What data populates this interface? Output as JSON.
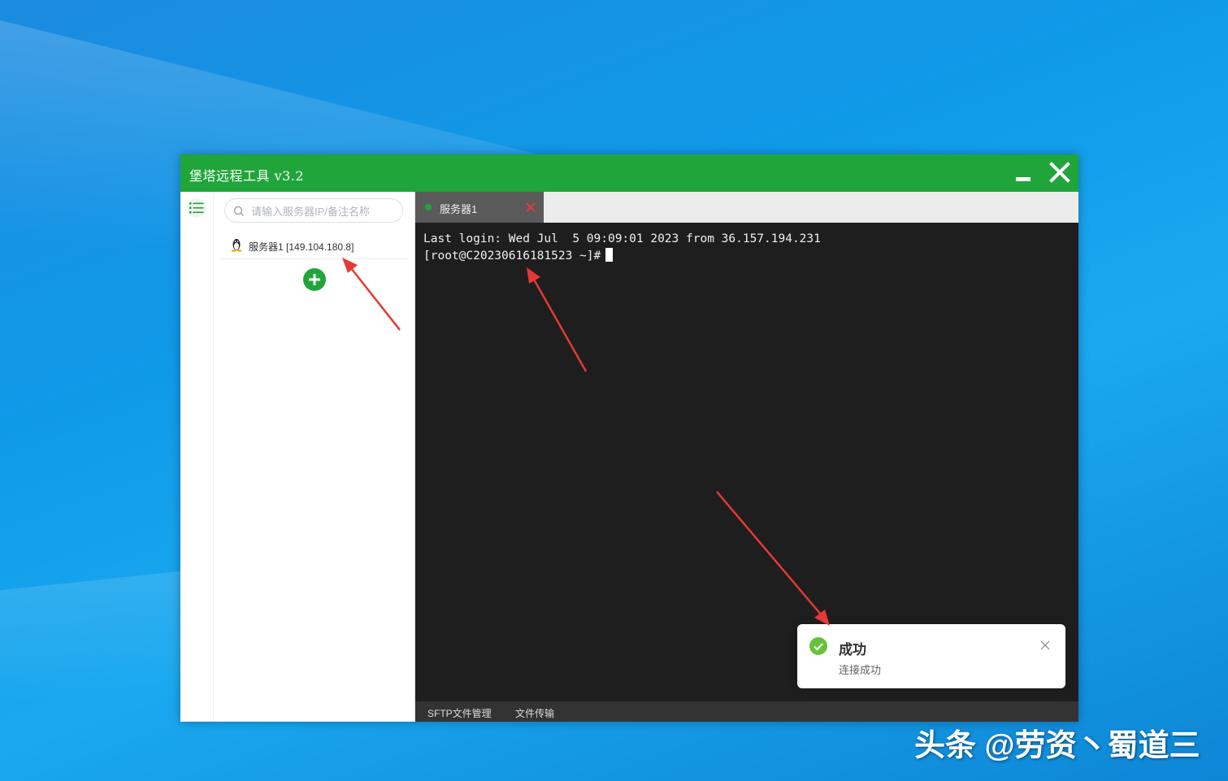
{
  "window": {
    "title": "堡塔远程工具 v3.2"
  },
  "sidebar": {
    "search_placeholder": "请输入服务器IP/备注名称",
    "servers": [
      {
        "label": "服务器1 [149.104.180.8]",
        "os_icon": "linux-icon"
      }
    ]
  },
  "tabs": [
    {
      "label": "服务器1",
      "status_color": "#20a53a"
    }
  ],
  "terminal": {
    "lines": [
      "Last login: Wed Jul  5 09:09:01 2023 from 36.157.194.231",
      "[root@C20230616181523 ~]#"
    ]
  },
  "bottombar": {
    "sftp_label": "SFTP文件管理",
    "transfer_label": "文件传输"
  },
  "toast": {
    "title": "成功",
    "message": "连接成功",
    "icon": "check-circle-icon",
    "color": "#67c23a"
  },
  "watermark": "头条 @劳资丶蜀道三",
  "colors": {
    "brand": "#20a53a",
    "terminal_bg": "#1e1e1e",
    "annotation_arrow": "#e53935"
  }
}
